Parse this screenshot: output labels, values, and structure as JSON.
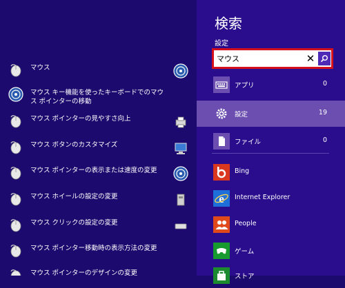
{
  "results": {
    "items": [
      {
        "label": "マウス",
        "icon": "mouse-icon"
      },
      {
        "label": "マウス キー機能を使ったキーボードでのマウス ポインターの移動",
        "icon": "ease-of-access-icon"
      },
      {
        "label": "マウス ポインターの見やすさ向上",
        "icon": "mouse-icon"
      },
      {
        "label": "マウス ボタンのカスタマイズ",
        "icon": "mouse-icon"
      },
      {
        "label": "マウス ポインターの表示または速度の変更",
        "icon": "mouse-icon"
      },
      {
        "label": "マウス ホイールの設定の変更",
        "icon": "mouse-icon"
      },
      {
        "label": "マウス クリックの設定の変更",
        "icon": "mouse-icon"
      },
      {
        "label": "マウス ポインター移動時の表示方法の変更",
        "icon": "mouse-icon"
      },
      {
        "label": "マウス ポインターのデザインの変更",
        "icon": "mouse-icon"
      }
    ],
    "side_icons": [
      "ease-of-access-icon",
      "devices-printers-icon",
      "network-icon",
      "ease-of-access-icon",
      "system-device-icon",
      "touchpad-icon"
    ]
  },
  "pane": {
    "title": "検索",
    "scope": "設定",
    "search_value": "マウス",
    "clear_glyph": "✕",
    "categories": [
      {
        "label": "アプリ",
        "count": "0",
        "icon": "apps-keyboard-icon"
      },
      {
        "label": "設定",
        "count": "19",
        "icon": "settings-gear-icon"
      },
      {
        "label": "ファイル",
        "count": "0",
        "icon": "file-icon"
      }
    ],
    "apps": [
      {
        "label": "Bing",
        "icon": "bing-icon",
        "color": "#d9381e"
      },
      {
        "label": "Internet Explorer",
        "icon": "internet-explorer-icon",
        "color": "#1e6fd9"
      },
      {
        "label": "People",
        "icon": "people-icon",
        "color": "#e04a1a"
      },
      {
        "label": "ゲーム",
        "icon": "games-icon",
        "color": "#179a2e"
      },
      {
        "label": "ストア",
        "icon": "store-icon",
        "color": "#1c8a2e"
      }
    ]
  },
  "colors": {
    "background": "#1c0a6e",
    "pane": "#290d8d",
    "selected": "#6b4eb0",
    "highlight": "#d4101d",
    "accent": "#4f2ab7"
  }
}
